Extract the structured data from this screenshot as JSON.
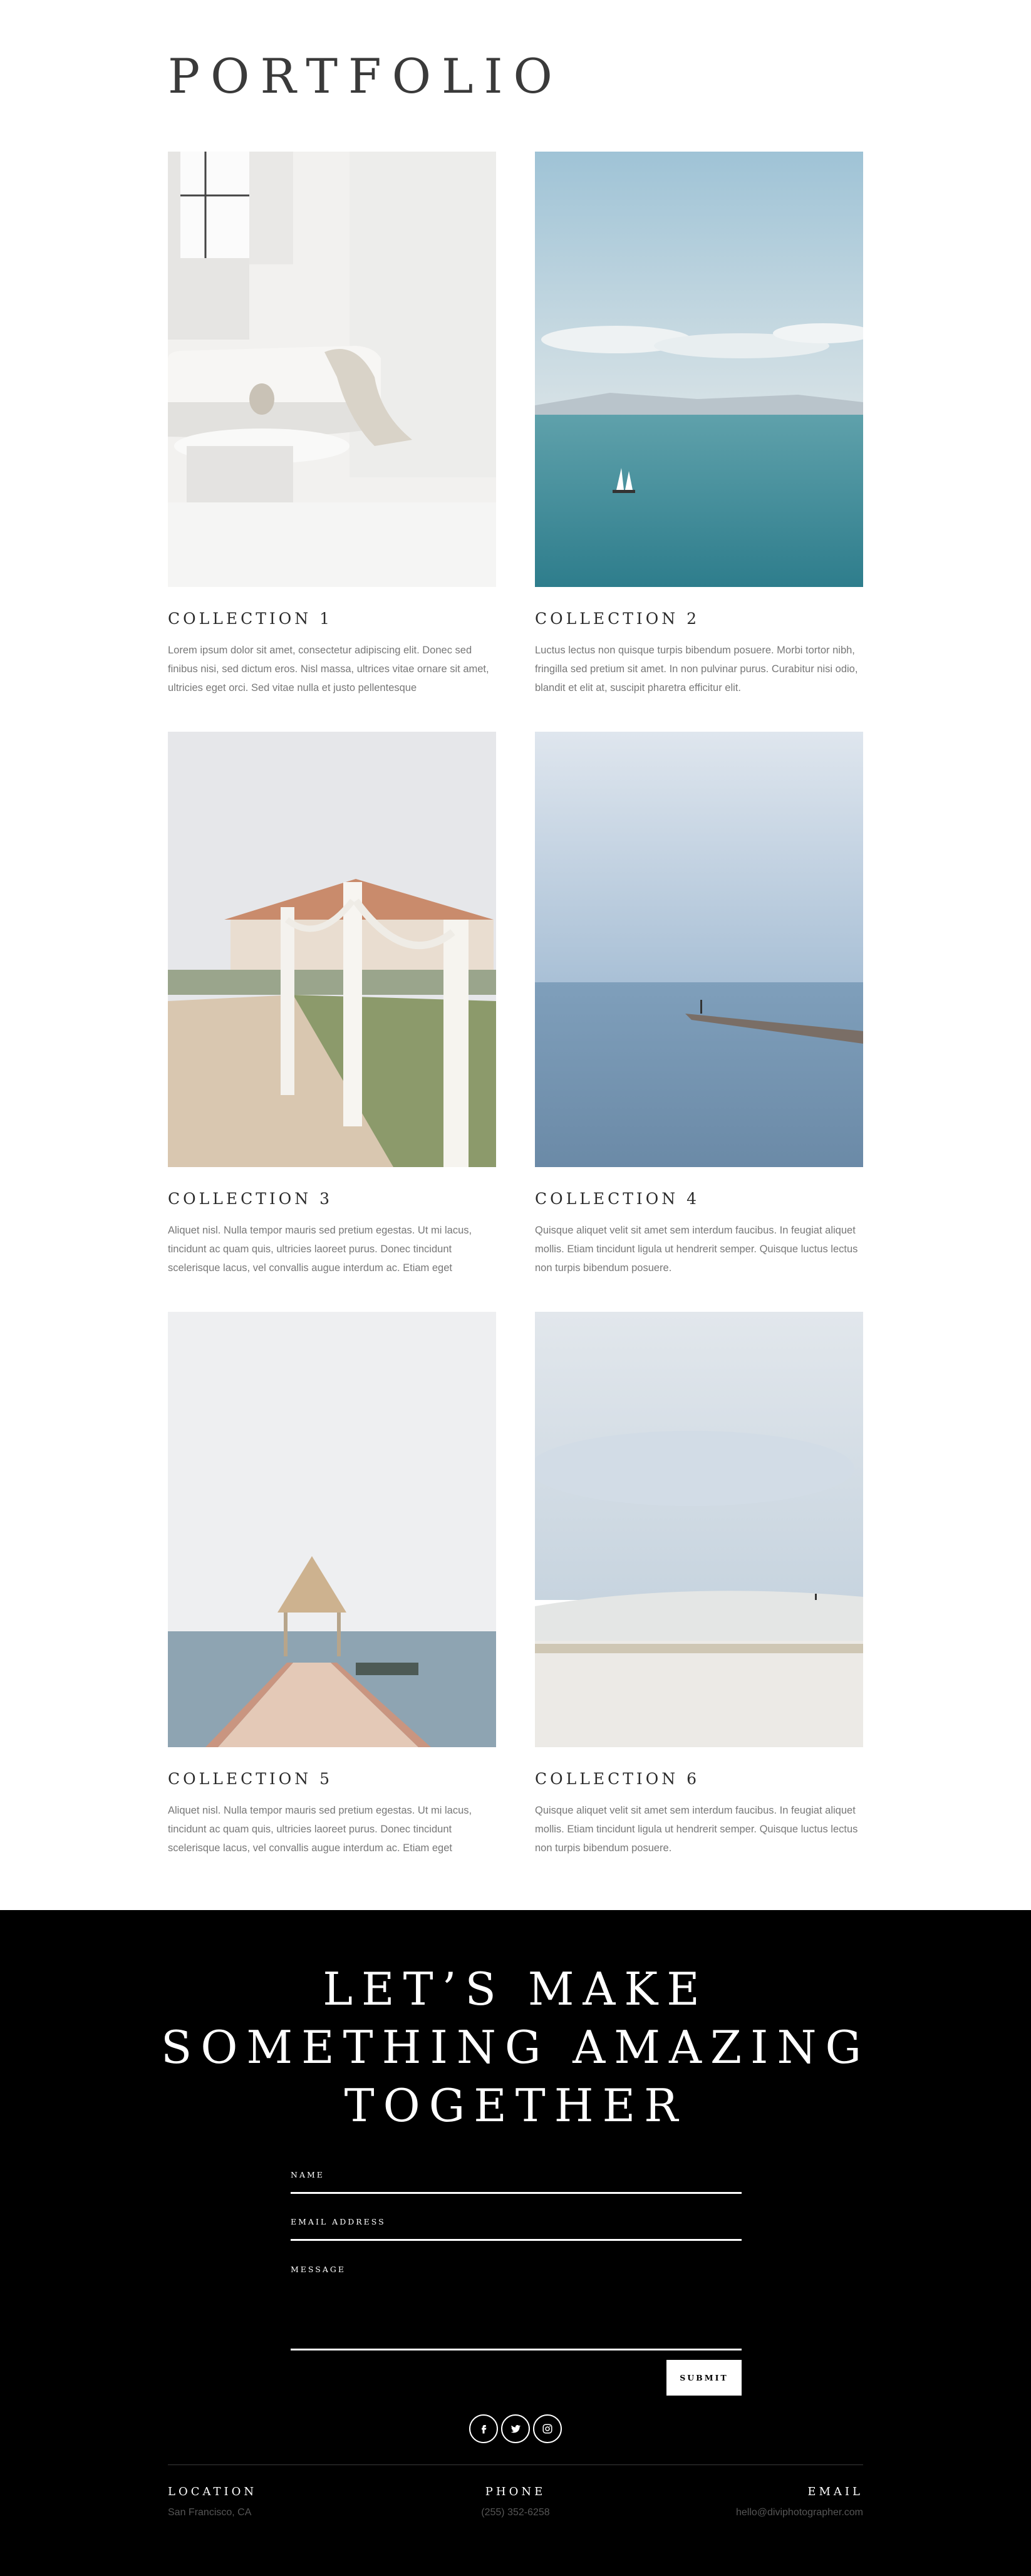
{
  "portfolio": {
    "title": "PORTFOLIO",
    "collections": [
      {
        "title": "COLLECTION 1",
        "text": "Lorem ipsum dolor sit amet, consectetur adipiscing elit. Donec sed finibus nisi, sed dictum eros. Nisl massa, ultrices vitae ornare sit amet, ultricies eget orci. Sed vitae nulla et justo pellentesque",
        "image_alt": "white living room with curved sofa and marble table"
      },
      {
        "title": "COLLECTION 2",
        "text": "Luctus lectus non quisque turpis bibendum posuere. Morbi tortor nibh, fringilla sed pretium sit amet. In non pulvinar purus. Curabitur nisi odio, blandit et elit at, suscipit pharetra efficitur elit.",
        "image_alt": "sailboat on turquoise sea"
      },
      {
        "title": "COLLECTION 3",
        "text": "Aliquet nisl. Nulla tempor mauris sed pretium egestas. Ut mi lacus, tincidunt ac quam quis, ultricies laoreet purus. Donec tincidunt scelerisque lacus, vel convallis augue interdum ac. Etiam eget",
        "image_alt": "rope fence path to beach house"
      },
      {
        "title": "COLLECTION 4",
        "text": "Quisque aliquet velit sit amet sem interdum faucibus. In feugiat aliquet mollis. Etiam tincidunt ligula ut hendrerit semper. Quisque luctus lectus non turpis bibendum posuere.",
        "image_alt": "person on pier over calm sea"
      },
      {
        "title": "COLLECTION 5",
        "text": "Aliquet nisl. Nulla tempor mauris sed pretium egestas. Ut mi lacus, tincidunt ac quam quis, ultricies laoreet purus. Donec tincidunt scelerisque lacus, vel convallis augue interdum ac. Etiam eget",
        "image_alt": "wooden walkway to thatched gazebo"
      },
      {
        "title": "COLLECTION 6",
        "text": "Quisque aliquet velit sit amet sem interdum faucibus. In feugiat aliquet mollis. Etiam tincidunt ligula ut hendrerit semper. Quisque luctus lectus non turpis bibendum posuere.",
        "image_alt": "white sand dunes under cloudy sky"
      }
    ]
  },
  "contact": {
    "headline": [
      "LET’S MAKE",
      "SOMETHING AMAZING",
      "TOGETHER"
    ],
    "fields": {
      "name": "NAME",
      "email": "EMAIL ADDRESS",
      "message": "MESSAGE"
    },
    "submit_label": "SUBMIT",
    "social_icons": [
      "facebook-icon",
      "twitter-icon",
      "instagram-icon"
    ]
  },
  "footer": {
    "location": {
      "label": "LOCATION",
      "value": "San Francisco, CA"
    },
    "phone": {
      "label": "PHONE",
      "value": "(255) 352-6258"
    },
    "email": {
      "label": "EMAIL",
      "value": "hello@diviphotographer.com"
    }
  },
  "colors": {
    "background": "#ffffff",
    "footer_background": "#000000",
    "body_text": "#777777",
    "accent": "#ffffff"
  }
}
